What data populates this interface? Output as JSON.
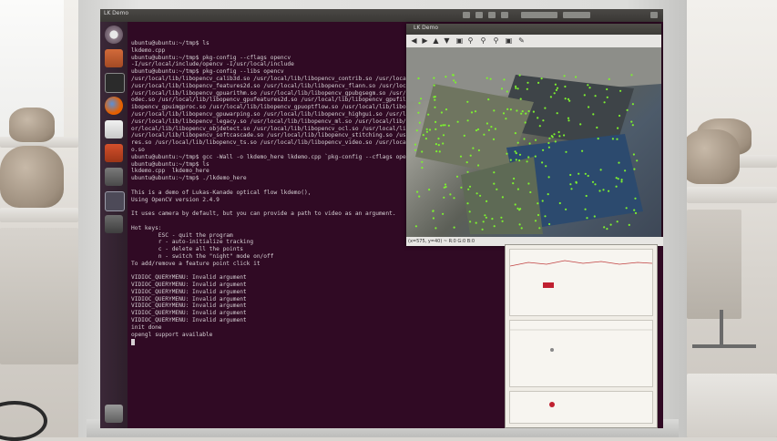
{
  "window": {
    "title": "LK Demo",
    "lk_title": "LK Demo"
  },
  "terminal": {
    "lines": [
      "ubuntu@ubuntu:~/tmp$ ls",
      "lkdemo.cpp",
      "ubuntu@ubuntu:~/tmp$ pkg-config --cflags opencv",
      "-I/usr/local/include/opencv -I/usr/local/include",
      "ubuntu@ubuntu:~/tmp$ pkg-config --libs opencv",
      "/usr/local/lib/libopencv_calib3d.so /usr/local/lib/libopencv_contrib.so /usr/local/",
      "/usr/local/lib/libopencv_features2d.so /usr/local/lib/libopencv_flann.so /usr/local/",
      "/usr/local/lib/libopencv_gpuarithm.so /usr/local/lib/libopencv_gpubgsegm.so /usr/loc",
      "odec.so /usr/local/lib/libopencv_gpufeatures2d.so /usr/local/lib/libopencv_gpufilter",
      "ibopencv_gpuimgproc.so /usr/local/lib/libopencv_gpuoptflow.so /usr/local/lib/libopenc",
      "/usr/local/lib/libopencv_gpuwarping.so /usr/local/lib/libopencv_highgui.so /usr/loca",
      "/usr/local/lib/libopencv_legacy.so /usr/local/lib/libopencv_ml.so /usr/local/lib/lib",
      "or/local/lib/libopencv_objdetect.so /usr/local/lib/libopencv_ocl.so /usr/local/lib/l",
      "/usr/local/lib/libopencv_softcascade.so /usr/local/lib/libopencv_stitching.so /usr/lo",
      "res.so /usr/local/lib/libopencv_ts.so /usr/local/lib/libopencv_video.so /usr/local/l",
      "o.so",
      "ubuntu@ubuntu:~/tmp$ gcc -Wall -o lkdemo_here lkdemo.cpp `pkg-config --cflags opencv",
      "ubuntu@ubuntu:~/tmp$ ls",
      "lkdemo.cpp  lkdemo_here",
      "ubuntu@ubuntu:~/tmp$ ./lkdemo_here",
      "",
      "This is a demo of Lukas-Kanade optical flow lkdemo(),",
      "Using OpenCV version 2.4.9",
      "",
      "It uses camera by default, but you can provide a path to video as an argument.",
      "",
      "Hot keys:",
      "        ESC - quit the program",
      "        r - auto-initialize tracking",
      "        c - delete all the points",
      "        n - switch the \"night\" mode on/off",
      "To add/remove a feature point click it",
      "",
      "VIDIOC_QUERYMENU: Invalid argument",
      "VIDIOC_QUERYMENU: Invalid argument",
      "VIDIOC_QUERYMENU: Invalid argument",
      "VIDIOC_QUERYMENU: Invalid argument",
      "VIDIOC_QUERYMENU: Invalid argument",
      "VIDIOC_QUERYMENU: Invalid argument",
      "VIDIOC_QUERYMENU: Invalid argument",
      "init done",
      "opengl support available"
    ]
  },
  "lk_status": "(x=575, y=40) ~ R:0 G:0 B:0",
  "colors": {
    "terminal_bg": "#300a24",
    "tracking_point": "#7cf030",
    "launcher_bg": "#3b2838",
    "firefox": "#e66000"
  },
  "icons": [
    "dash-icon",
    "files-icon",
    "terminal-icon",
    "firefox-icon",
    "document-icon",
    "presentation-icon",
    "settings-icon",
    "workspace-icon",
    "trash-icon"
  ]
}
